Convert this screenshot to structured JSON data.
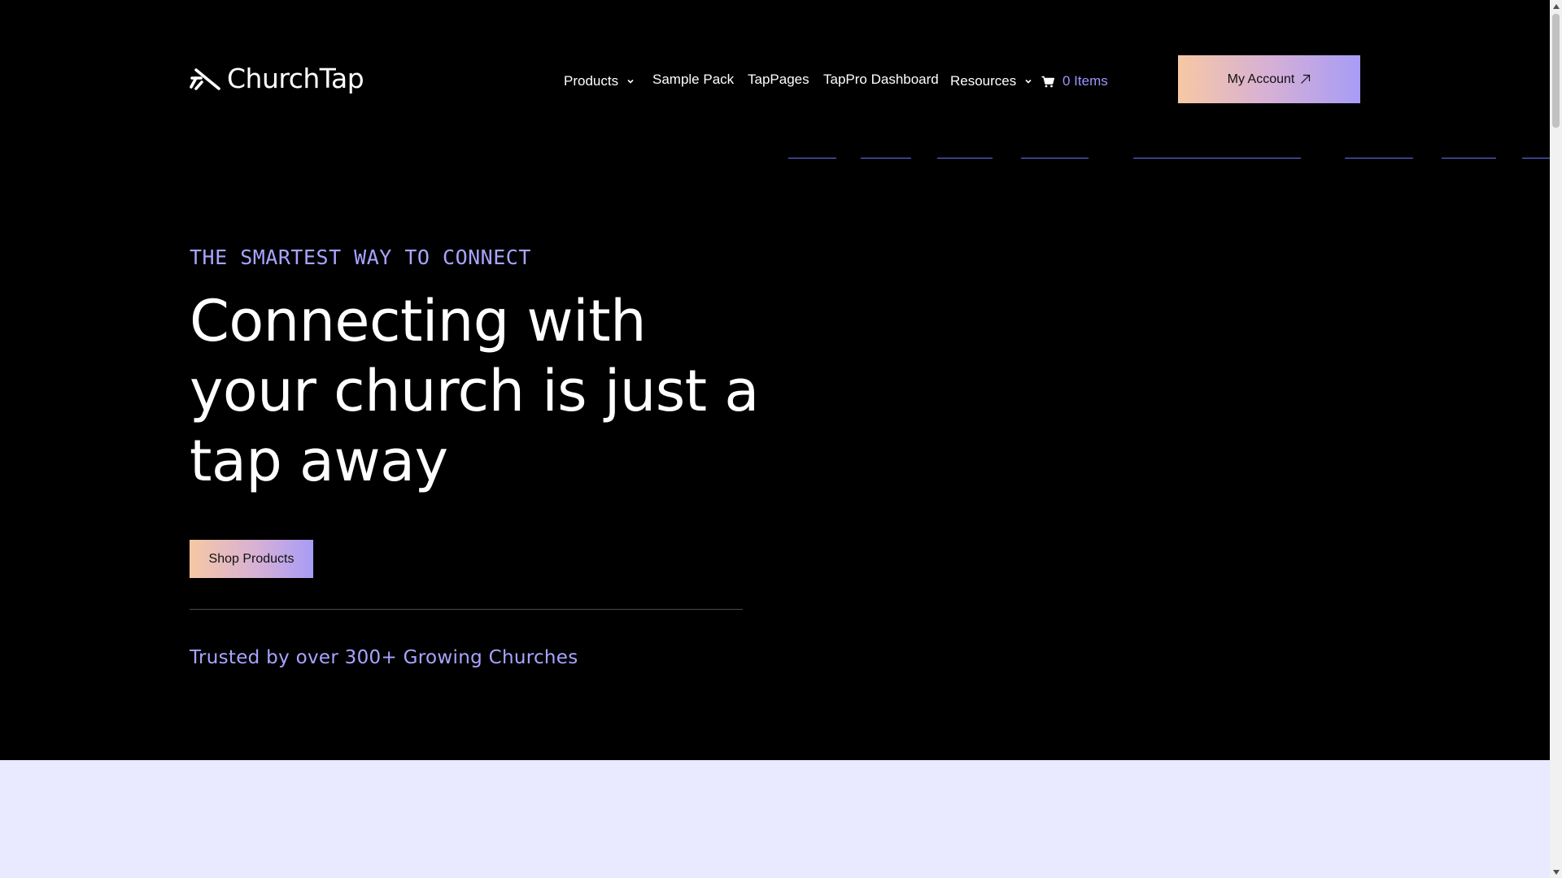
{
  "header": {
    "logo_text": "ChurchTap",
    "nav": [
      {
        "label": "Products",
        "dropdown": true
      },
      {
        "label": "Sample Pack",
        "dropdown": false
      },
      {
        "label": "TapPages",
        "dropdown": false
      },
      {
        "label": "TapPro Dashboard",
        "dropdown": false
      },
      {
        "label": "Resources",
        "dropdown": true
      }
    ],
    "cart_label": "0 Items",
    "account_label": "My Account"
  },
  "hero": {
    "eyebrow": "THE SMARTEST WAY TO CONNECT",
    "headline": "Connecting with your church is just a tap away",
    "cta_label": "Shop Products",
    "trusted": "Trusted by over 300+ Growing Churches"
  },
  "colors": {
    "background": "#000000",
    "accent": "#a9a4ff",
    "gradient_start": "#f7c8a4",
    "gradient_end": "#a79cf6",
    "lower_section": "#e9e9ff"
  },
  "icons": {
    "logo": "tap-hand-icon",
    "dropdown": "chevron-down-icon",
    "cart": "cart-icon",
    "external": "arrow-up-right-icon"
  }
}
